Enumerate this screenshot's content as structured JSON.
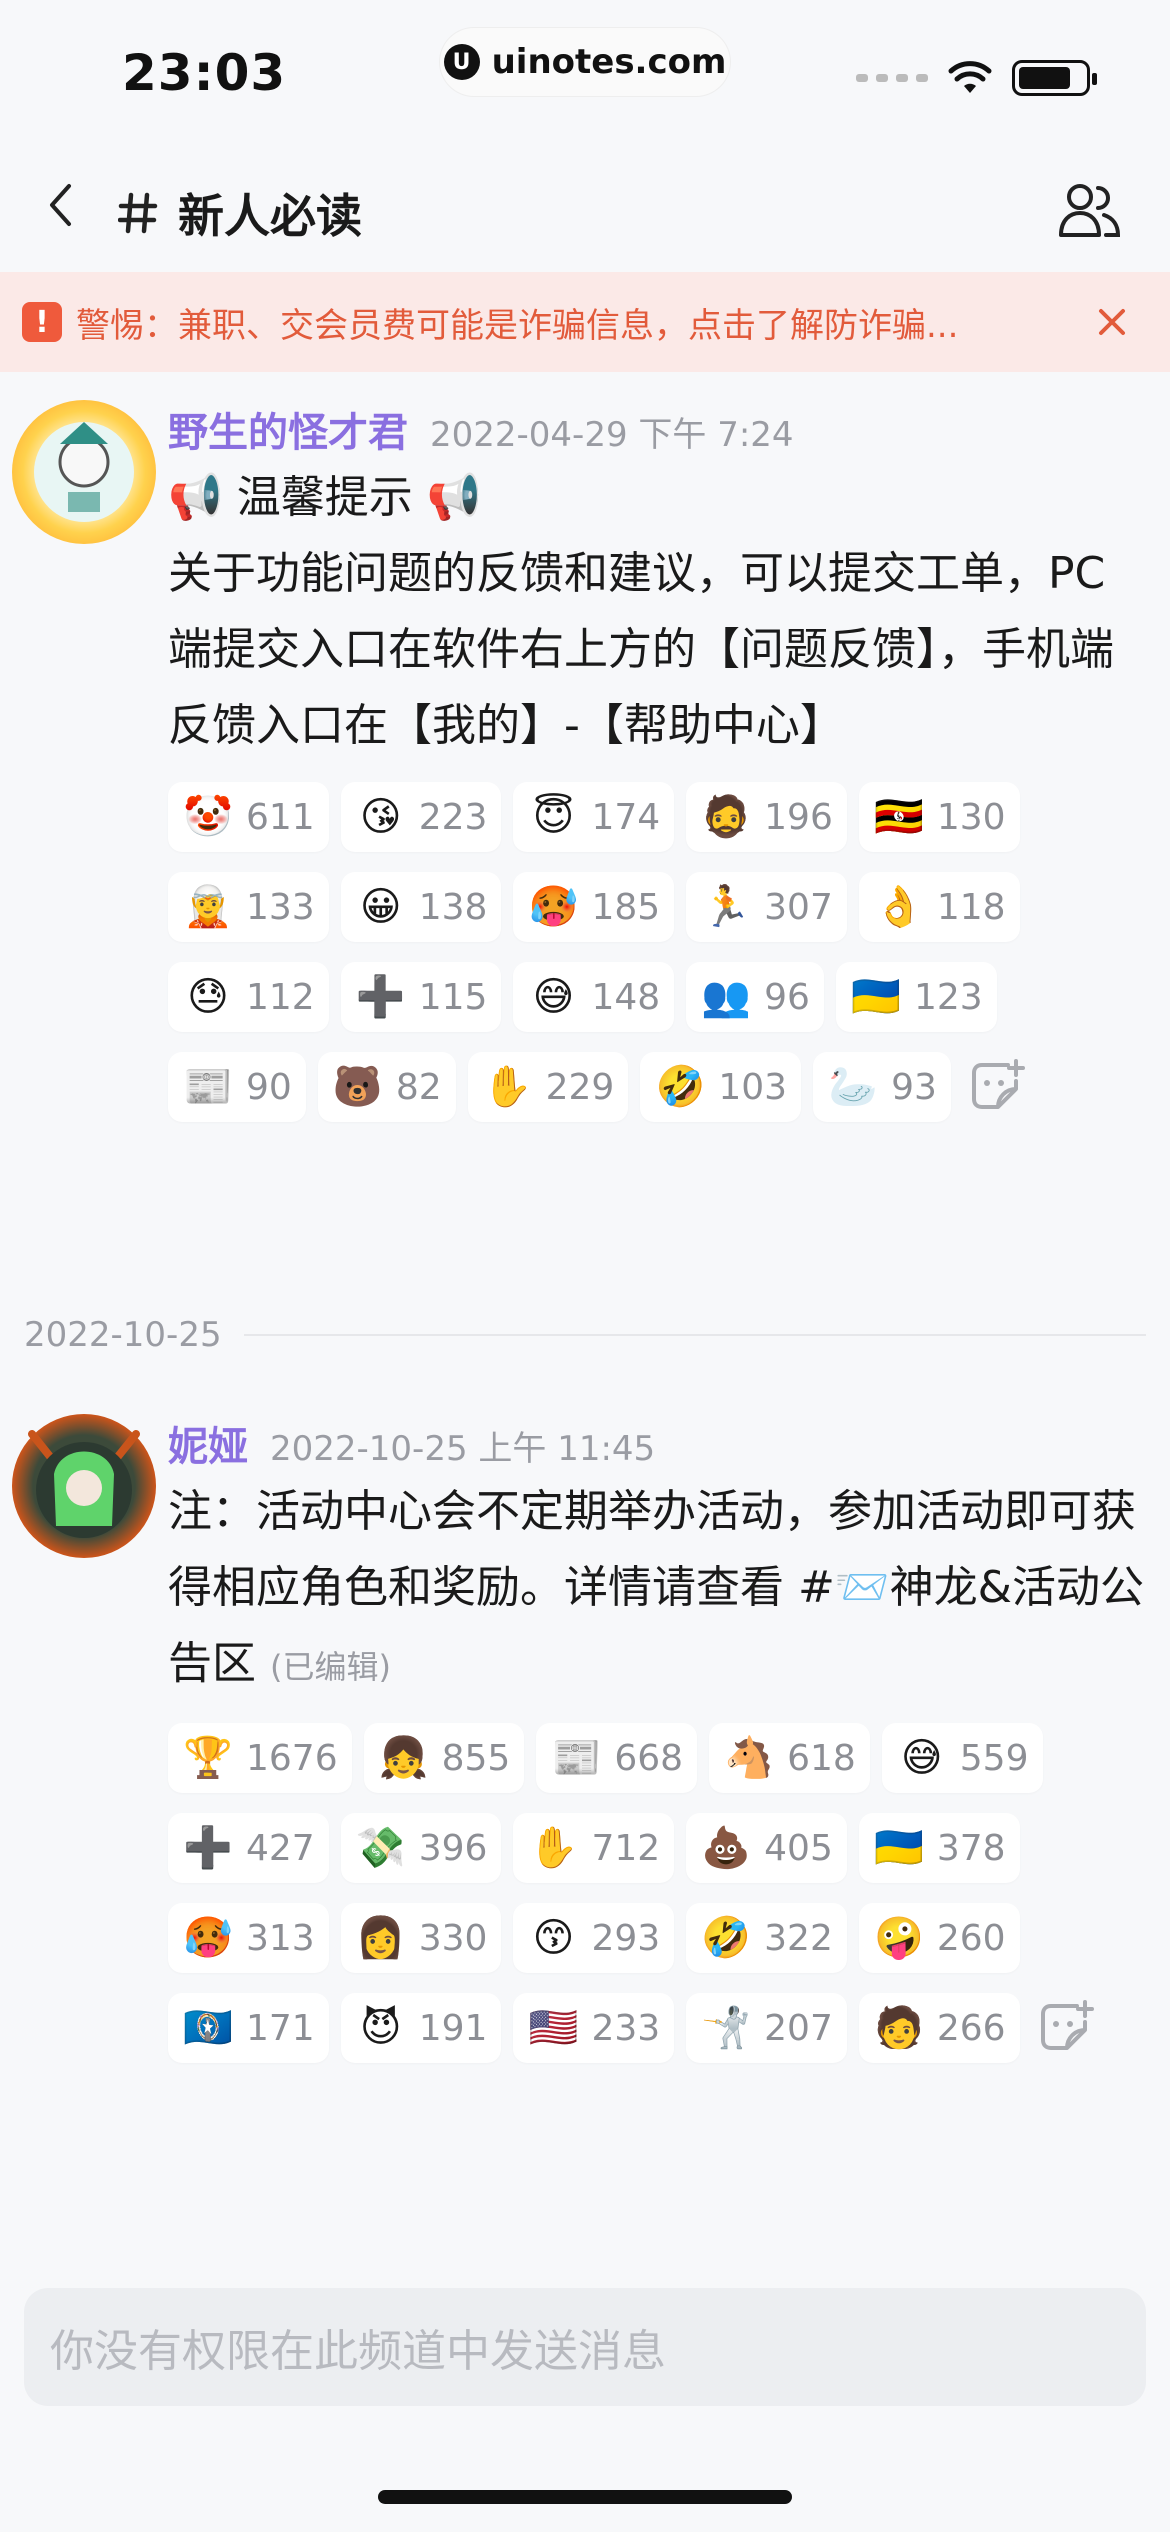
{
  "status_bar": {
    "time": "23:03",
    "url": "uinotes.com"
  },
  "nav": {
    "channel_name": "新人必读"
  },
  "banner": {
    "text": "警惕：兼职、交会员费可能是诈骗信息，点击了解防诈骗..."
  },
  "messages": [
    {
      "author": "野生的怪才君",
      "author_color": "#8a6fe0",
      "timestamp": "2022-04-29 下午 7:24",
      "line1": "📢 温馨提示 📢",
      "line2": "关于功能问题的反馈和建议，可以提交工单，PC端提交入口在软件右上方的【问题反馈】，手机端反馈入口在【我的】-【帮助中心】",
      "reactions": [
        {
          "emoji": "🤡",
          "count": "611"
        },
        {
          "emoji": "😘",
          "count": "223"
        },
        {
          "emoji": "😇",
          "count": "174"
        },
        {
          "emoji": "🧔",
          "count": "196"
        },
        {
          "emoji": "🇺🇬",
          "count": "130"
        },
        {
          "emoji": "🧝",
          "count": "133"
        },
        {
          "emoji": "😀",
          "count": "138"
        },
        {
          "emoji": "🥵",
          "count": "185"
        },
        {
          "emoji": "🏃",
          "count": "307"
        },
        {
          "emoji": "👌",
          "count": "118"
        },
        {
          "emoji": "😓",
          "count": "112"
        },
        {
          "emoji": "➕",
          "count": "115"
        },
        {
          "emoji": "😅",
          "count": "148"
        },
        {
          "emoji": "👥",
          "count": "96"
        },
        {
          "emoji": "🇺🇦",
          "count": "123"
        },
        {
          "emoji": "📰",
          "count": "90"
        },
        {
          "emoji": "🐻",
          "count": "82"
        },
        {
          "emoji": "✋",
          "count": "229"
        },
        {
          "emoji": "🤣",
          "count": "103"
        },
        {
          "emoji": "🦢",
          "count": "93"
        }
      ]
    },
    {
      "author": "妮娅",
      "author_color": "#8a6fe0",
      "timestamp": "2022-10-25 上午 11:45",
      "text_main": "注：活动中心会不定期举办活动，参加活动即可获得相应角色和奖励。详情请查看 #📨",
      "channel_ref": "神龙&活动公告区",
      "edited": "(已编辑)",
      "reactions": [
        {
          "emoji": "🏆",
          "count": "1676"
        },
        {
          "emoji": "👧",
          "count": "855"
        },
        {
          "emoji": "📰",
          "count": "668"
        },
        {
          "emoji": "🐴",
          "count": "618"
        },
        {
          "emoji": "😅",
          "count": "559"
        },
        {
          "emoji": "➕",
          "count": "427"
        },
        {
          "emoji": "💸",
          "count": "396"
        },
        {
          "emoji": "✋",
          "count": "712"
        },
        {
          "emoji": "💩",
          "count": "405"
        },
        {
          "emoji": "🇺🇦",
          "count": "378"
        },
        {
          "emoji": "🥵",
          "count": "313"
        },
        {
          "emoji": "👩",
          "count": "330"
        },
        {
          "emoji": "😙",
          "count": "293"
        },
        {
          "emoji": "🤣",
          "count": "322"
        },
        {
          "emoji": "🤪",
          "count": "260"
        },
        {
          "emoji": "🇲🇵",
          "count": "171"
        },
        {
          "emoji": "😈",
          "count": "191"
        },
        {
          "emoji": "🇺🇸",
          "count": "233"
        },
        {
          "emoji": "🤺",
          "count": "207"
        },
        {
          "emoji": "🧑",
          "count": "266"
        }
      ]
    }
  ],
  "date_divider": "2022-10-25",
  "input": {
    "placeholder": "你没有权限在此频道中发送消息"
  }
}
